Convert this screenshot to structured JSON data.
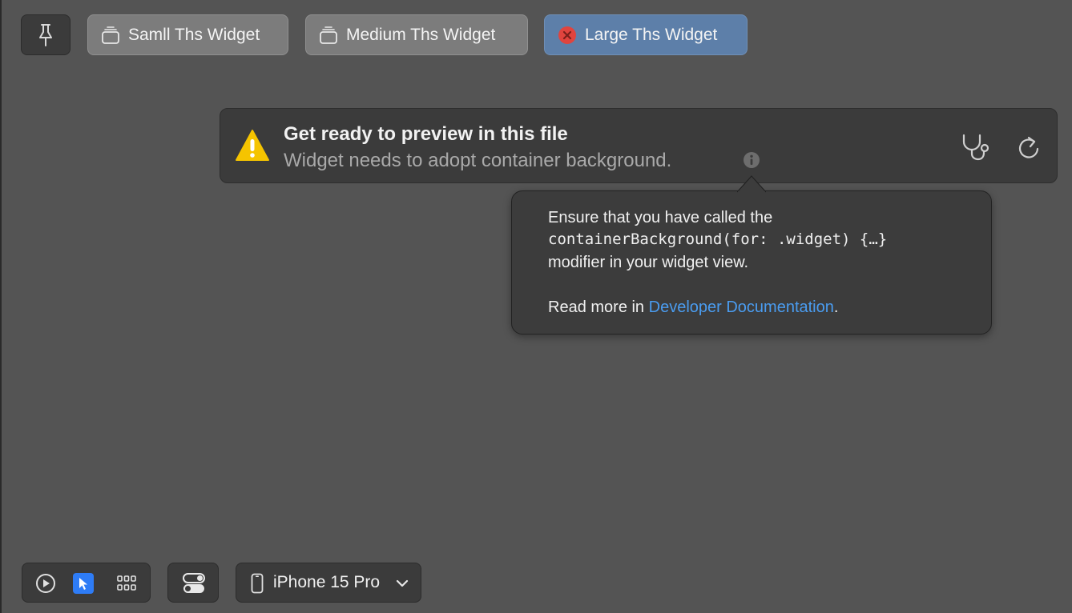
{
  "toolbar": {
    "pin_icon": "pin-icon",
    "variants": [
      {
        "label": "Samll Ths Widget",
        "icon": "stack-icon",
        "selected": false
      },
      {
        "label": "Medium Ths Widget",
        "icon": "stack-icon",
        "selected": false
      },
      {
        "label": "Large Ths Widget",
        "icon": "error-icon",
        "selected": true
      }
    ]
  },
  "banner": {
    "title": "Get ready to preview in this file",
    "subtitle": "Widget needs to adopt container background.",
    "icons": [
      "warning-icon",
      "info-icon",
      "diagnostics-icon",
      "refresh-icon"
    ]
  },
  "popover": {
    "line1": "Ensure that you have called the",
    "code": "containerBackground(for: .widget) {…}",
    "line3": "modifier in your widget view.",
    "read_more_prefix": "Read more in ",
    "link_text": "Developer Documentation",
    "read_more_suffix": "."
  },
  "bottom_bar": {
    "modes": [
      "live-preview-icon",
      "selectable-icon",
      "variants-grid-icon"
    ],
    "active_mode": "selectable-icon",
    "settings_icon": "canvas-settings-icon",
    "device": "iPhone 15 Pro"
  },
  "colors": {
    "background": "#545454",
    "panel": "#3b3b3b",
    "selected_button": "#5d7fa9",
    "warning": "#f5c400",
    "error": "#e0443e",
    "link": "#4a9cf0",
    "active_mode": "#2e7cf6"
  }
}
